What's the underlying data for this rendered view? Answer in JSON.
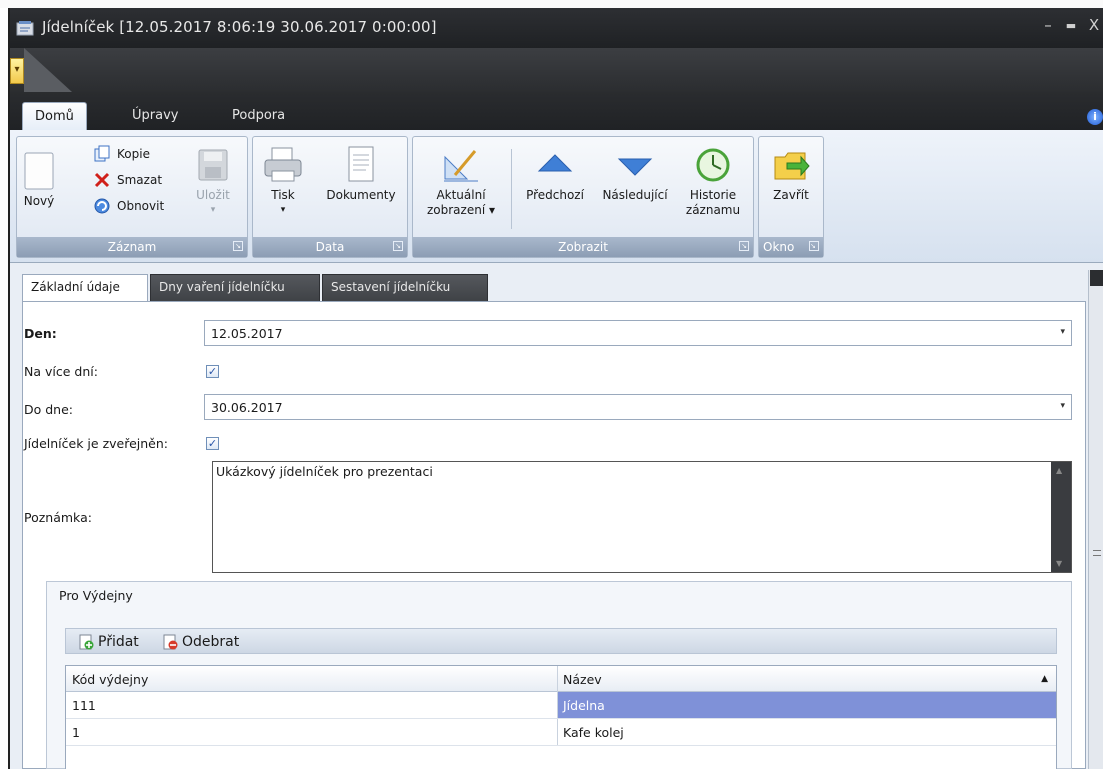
{
  "window": {
    "title": "Jídelníček [12.05.2017 8:06:19 30.06.2017 0:00:00]",
    "minimize": "–",
    "maximize": "▬",
    "close": "X"
  },
  "qat": {
    "menu_glyph": "▾"
  },
  "ribbon_tabs": [
    {
      "label": "Domů",
      "active": true
    },
    {
      "label": "Úpravy",
      "active": false
    },
    {
      "label": "Podpora",
      "active": false
    }
  ],
  "info_glyph": "i",
  "ribbon": {
    "zaznam": {
      "label": "Záznam",
      "novy": "Nový",
      "kopie": "Kopie",
      "smazat": "Smazat",
      "obnovit": "Obnovit",
      "ulozit": "Uložit"
    },
    "data": {
      "label": "Data",
      "tisk": "Tisk",
      "dokumenty": "Dokumenty"
    },
    "zobrazit": {
      "label": "Zobrazit",
      "aktualni_1": "Aktuální",
      "aktualni_2": "zobrazení ▾",
      "predchozi": "Předchozí",
      "nasledujici": "Následující",
      "historie_1": "Historie",
      "historie_2": "záznamu"
    },
    "okno": {
      "label": "Okno",
      "zavrit": "Zavřít"
    },
    "launcher_glyph": "↘",
    "dropdown_glyph": "▾"
  },
  "subtabs": [
    {
      "label": "Základní údaje",
      "active": true
    },
    {
      "label": "Dny vaření jídelníčku",
      "active": false
    },
    {
      "label": "Sestavení jídelníčku",
      "active": false
    }
  ],
  "form": {
    "den_label": "Den:",
    "den_value": "12.05.2017",
    "na_vice_dni_label": "Na více dní:",
    "na_vice_dni_checked": true,
    "do_dne_label": "Do dne:",
    "do_dne_value": "30.06.2017",
    "zverejnen_label": "Jídelníček je zveřejněn:",
    "zverejnen_checked": true,
    "poznamka_label": "Poznámka:",
    "poznamka_value": "Ukázkový jídelníček pro prezentaci",
    "check_glyph": "✓",
    "combo_arrow": "▾"
  },
  "vydejny": {
    "title": "Pro Výdejny",
    "pridat": "Přidat",
    "odebrat": "Odebrat",
    "columns": [
      "Kód výdejny",
      "Název"
    ],
    "sort_glyph": "▲",
    "rows": [
      {
        "kod": "111",
        "nazev": "Jídelna",
        "selected": true
      },
      {
        "kod": "1",
        "nazev": "Kafe kolej",
        "selected": false
      }
    ]
  },
  "colors": {
    "titlebar": "#2d2f33",
    "ribbon_group_label": "#8c9db4",
    "selection": "#7f91d8",
    "checkbox_border": "#6f8fb8"
  }
}
